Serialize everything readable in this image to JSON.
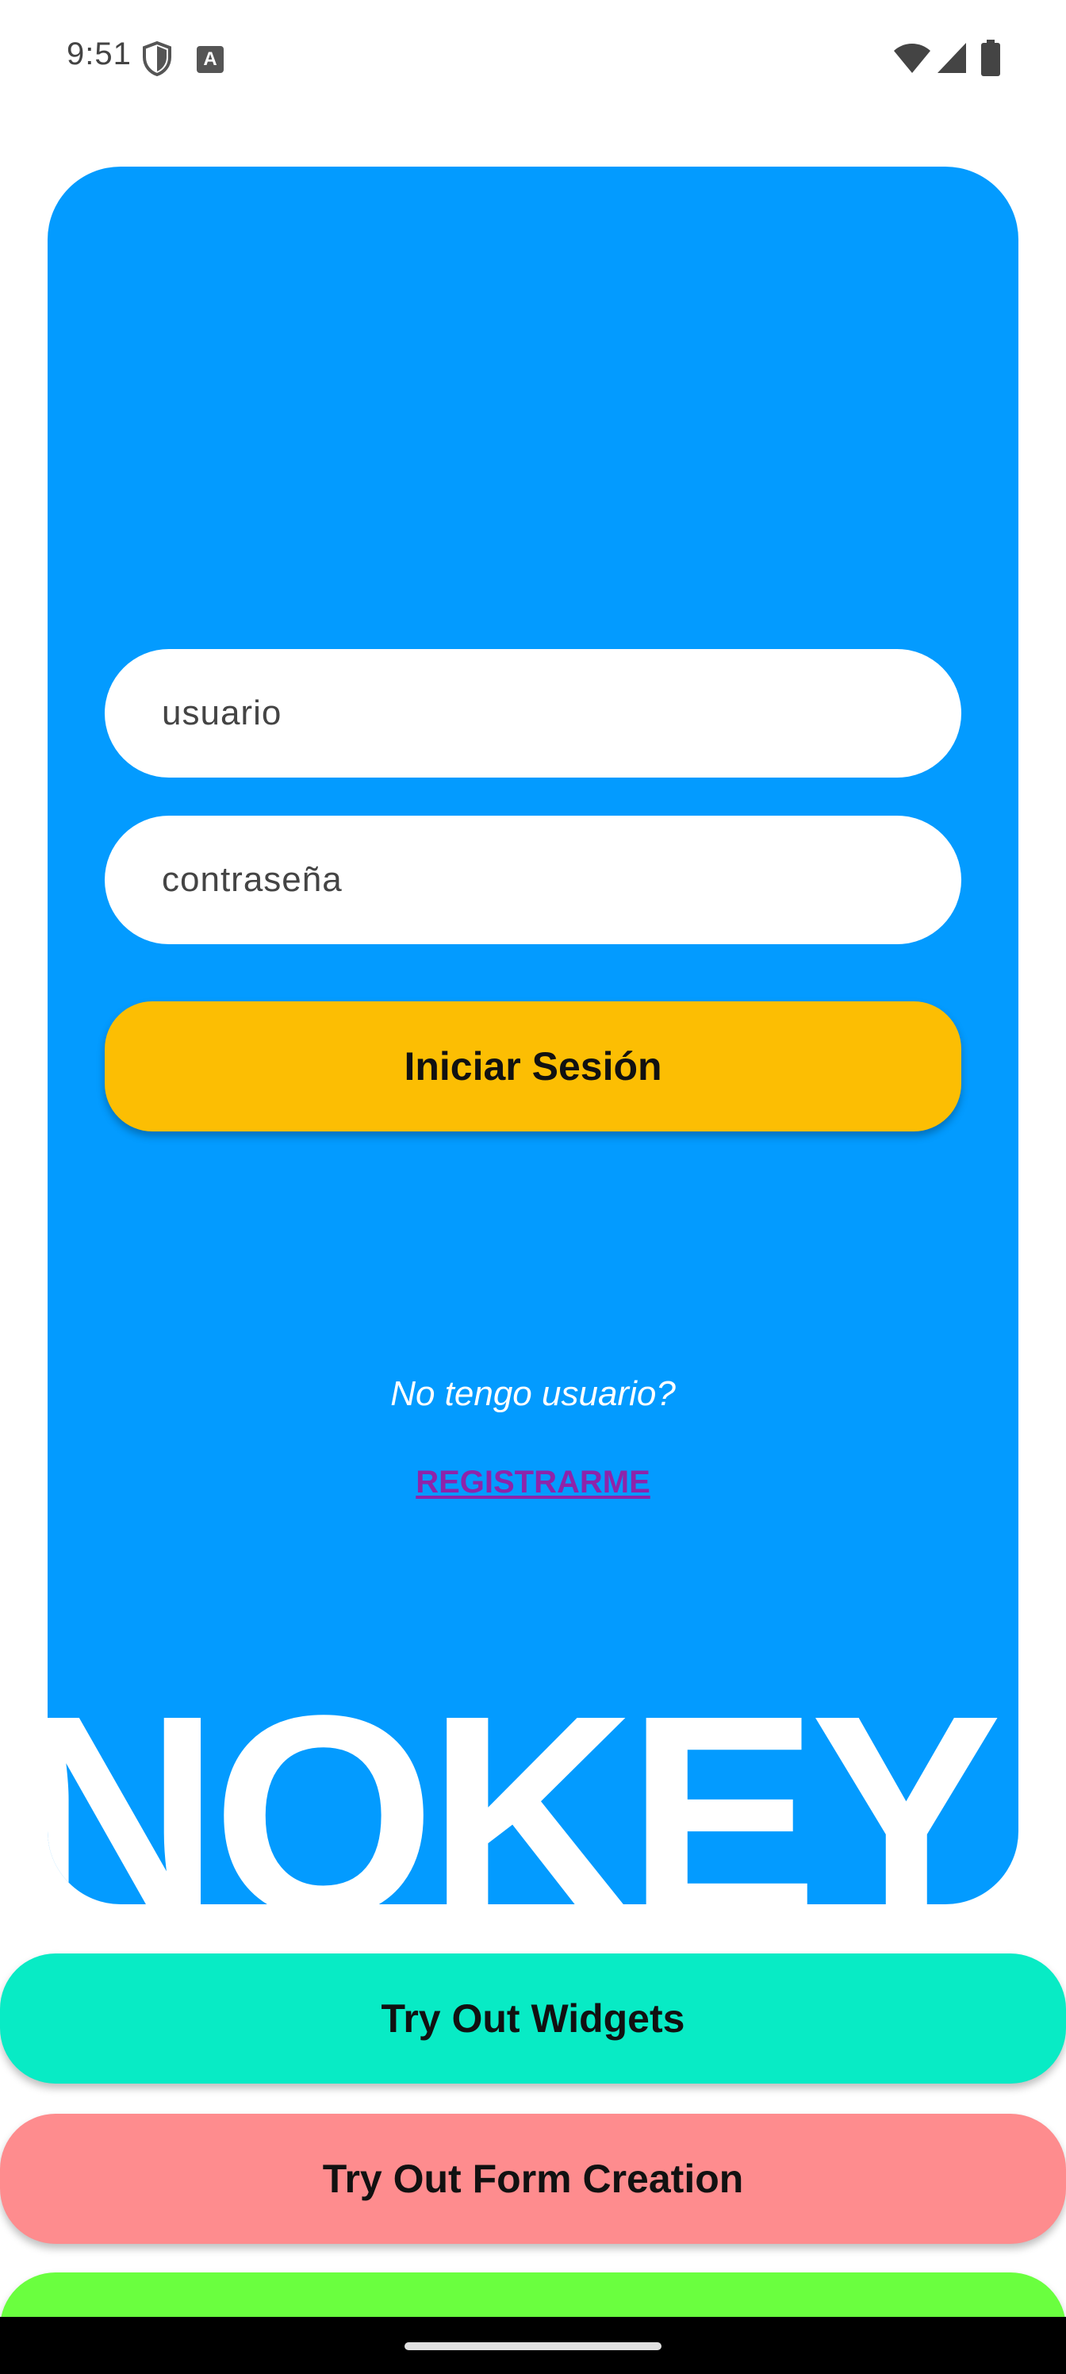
{
  "status_bar": {
    "time": "9:51",
    "a_badge": "A",
    "icons": [
      "shield-icon",
      "keyboard-a-icon",
      "wifi-icon",
      "signal-icon",
      "battery-icon"
    ]
  },
  "login": {
    "username_placeholder": "usuario",
    "password_placeholder": "contraseña",
    "login_button": "Iniciar Sesión",
    "no_user_text": "No tengo usuario?",
    "register_link": "REGISTRARME",
    "brand": "NOKEY"
  },
  "menu": {
    "widgets_button": "Try Out Widgets",
    "forms_button": "Try Out Form Creation",
    "third_button": ""
  },
  "colors": {
    "card_background": "#039BFF",
    "login_button": "#FCBE03",
    "register_link": "#8E24AA",
    "widgets_button": "#08EBC5",
    "forms_button": "#FE8C8E",
    "third_button": "#6AFF3F"
  }
}
